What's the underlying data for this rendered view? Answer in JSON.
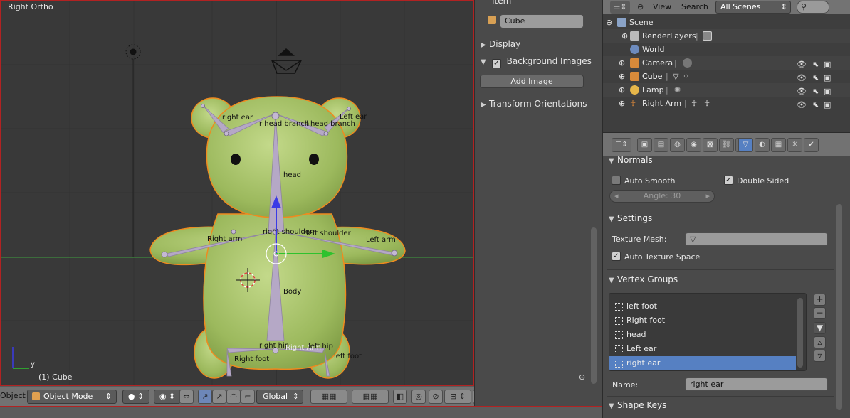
{
  "viewport": {
    "view_label": "Right Ortho",
    "object_label": "(1) Cube",
    "axis_y": "y",
    "bones": [
      "right ear",
      "r head branch",
      "l head branch",
      "Left ear",
      "head",
      "right shoulder",
      "left shoulder",
      "Right arm",
      "Left arm",
      "Body",
      "right hip",
      "Right Arm",
      "left hip",
      "Right foot",
      "left foot"
    ]
  },
  "header": {
    "menu_object": "Object",
    "mode": "Object Mode",
    "orientation": "Global"
  },
  "npanel": {
    "item_section": "Item",
    "item_name": "Cube",
    "display_section": "Display",
    "bg_images_section": "Background Images",
    "add_image": "Add Image",
    "transform_orient_section": "Transform Orientations"
  },
  "outliner": {
    "view_menu": "View",
    "search_menu": "Search",
    "scenes_select": "All Scenes",
    "rows": [
      "Scene",
      "RenderLayers",
      "World",
      "Camera",
      "Cube",
      "Lamp",
      "Right Arm"
    ]
  },
  "properties": {
    "normals_section": "Normals",
    "auto_smooth": "Auto Smooth",
    "double_sided": "Double Sided",
    "angle": "Angle: 30",
    "settings_section": "Settings",
    "texture_mesh": "Texture Mesh:",
    "auto_texture_space": "Auto Texture Space",
    "vertex_groups_section": "Vertex Groups",
    "vertex_groups": [
      "left foot",
      "Right foot",
      "head",
      "Left ear",
      "right ear"
    ],
    "name_label": "Name:",
    "name_value": "right ear",
    "shape_keys_section": "Shape Keys"
  },
  "colors": {
    "accent": "#5680c2",
    "bear": "#a9c46e",
    "bone": "#b5a8c6",
    "outline": "#f08a1e"
  }
}
